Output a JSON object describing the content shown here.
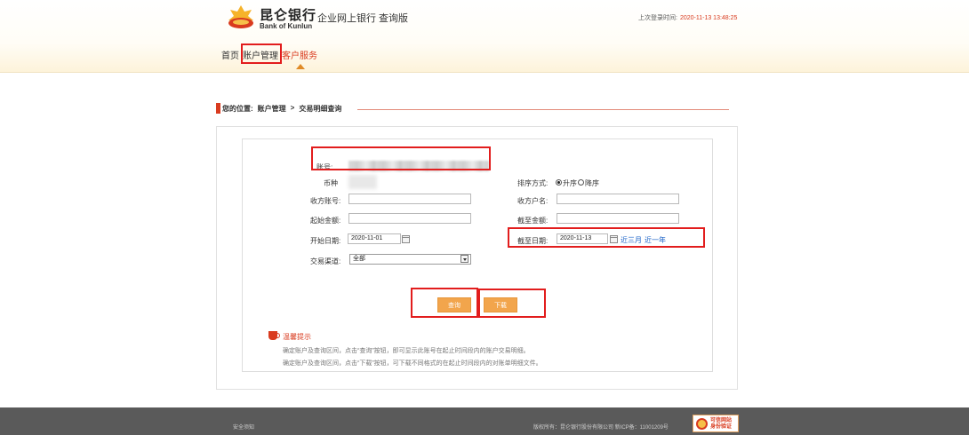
{
  "header": {
    "brand_cn": "昆仑银行",
    "brand_en": "Bank of Kunlun",
    "system_title": "企业网上银行 查询版",
    "last_login_label": "上次登录时间:",
    "last_login_time": "2020-11-13 13:48:25"
  },
  "nav": {
    "items": [
      {
        "label": "首页"
      },
      {
        "label": "账户管理"
      },
      {
        "label": "客户服务"
      }
    ]
  },
  "breadcrumb": {
    "prefix": "您的位置:",
    "level1": "账户管理",
    "separator": ">",
    "level2": "交易明细查询"
  },
  "form": {
    "account_label": "账号:",
    "currency_label": "币种",
    "sort_label": "排序方式:",
    "sort_asc": "升序",
    "sort_desc": "降序",
    "payee_account_label": "收方账号:",
    "payee_name_label": "收方户名:",
    "min_amount_label": "起始金额:",
    "max_amount_label": "截至金额:",
    "start_date_label": "开始日期:",
    "start_date_value": "2020-11-01",
    "end_date_label": "截至日期:",
    "end_date_value": "2020-11-13",
    "quick_3m": "近三月",
    "quick_1y": "近一年",
    "channel_label": "交易渠道:",
    "channel_value": "全部",
    "query_button": "查询",
    "download_button": "下载"
  },
  "tips": {
    "title": "温馨提示",
    "line1": "确定账户及查询区间，点击“查询”按钮，即可显示此账号在起止时间段内的账户交易明细。",
    "line2": "确定账户及查询区间，点击“下载”按钮，可下载不同格式的在起止时间段内的对账单明细文件。"
  },
  "footer": {
    "security_link": "安全须知",
    "copyright": "版权所有：昆仑银行股份有限公司  新ICP备：11001209号",
    "badge_line1": "可信网站",
    "badge_line2": "身份验证"
  },
  "colors": {
    "accent_red": "#d93b1f",
    "button_orange": "#f2a54c",
    "annotation_red": "#e21d1d",
    "link_blue": "#1e64c8"
  }
}
